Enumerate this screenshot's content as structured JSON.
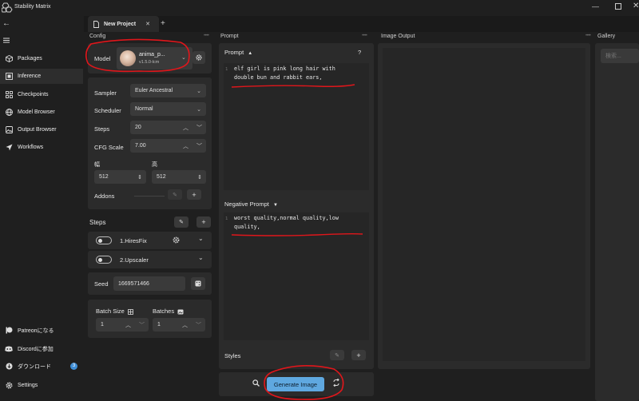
{
  "app": {
    "title": "Stability Matrix"
  },
  "sidebar": {
    "items": [
      {
        "label": "Packages",
        "icon": "box-icon"
      },
      {
        "label": "Inference",
        "icon": "layers-icon",
        "active": true
      },
      {
        "label": "Checkpoints",
        "icon": "grid-icon"
      },
      {
        "label": "Model Browser",
        "icon": "globe-icon"
      },
      {
        "label": "Output Browser",
        "icon": "image-icon"
      },
      {
        "label": "Workflows",
        "icon": "send-icon"
      }
    ],
    "bottom": [
      {
        "label": "Patreonになる",
        "icon": "patreon-icon"
      },
      {
        "label": "Discordに参加",
        "icon": "discord-icon"
      },
      {
        "label": "ダウンロード",
        "icon": "download-icon",
        "badge": "3"
      },
      {
        "label": "Settings",
        "icon": "gear-icon"
      }
    ]
  },
  "tabs": {
    "active": "New Project",
    "add": "+"
  },
  "columns": {
    "config": "Config",
    "prompt": "Prompt",
    "image_output": "Image Output",
    "gallery": "Gallery"
  },
  "config": {
    "model_label": "Model",
    "model_name": "anima_p...",
    "model_version": "v1.5.0-lcm",
    "sampler_label": "Sampler",
    "sampler_value": "Euler Ancestral",
    "scheduler_label": "Scheduler",
    "scheduler_value": "Normal",
    "steps_label": "Steps",
    "steps_value": "20",
    "cfg_label": "CFG Scale",
    "cfg_value": "7.00",
    "width_label": "幅",
    "width_value": "512",
    "height_label": "高",
    "height_value": "512",
    "addons_label": "Addons"
  },
  "steps_section": {
    "title": "Steps",
    "items": [
      {
        "label": "1.HiresFix"
      },
      {
        "label": "2.Upscaler"
      }
    ]
  },
  "seed": {
    "label": "Seed",
    "value": "1669571466"
  },
  "batch": {
    "size_label": "Batch Size",
    "size_value": "1",
    "batches_label": "Batches",
    "batches_value": "1"
  },
  "prompt": {
    "header": "Prompt",
    "help": "?",
    "line1": "elf girl is pink long hair with",
    "line2": "double bun and rabbit ears,",
    "negative_header": "Negative Prompt",
    "neg_line1": "worst quality,normal quality,low",
    "neg_line2": "quality,",
    "line_no": "1",
    "styles_label": "Styles"
  },
  "generate": {
    "label": "Generate Image"
  },
  "gallery": {
    "search_placeholder": "検索..."
  },
  "colors": {
    "accent": "#3f8ed6",
    "annotation": "#e0161b"
  }
}
